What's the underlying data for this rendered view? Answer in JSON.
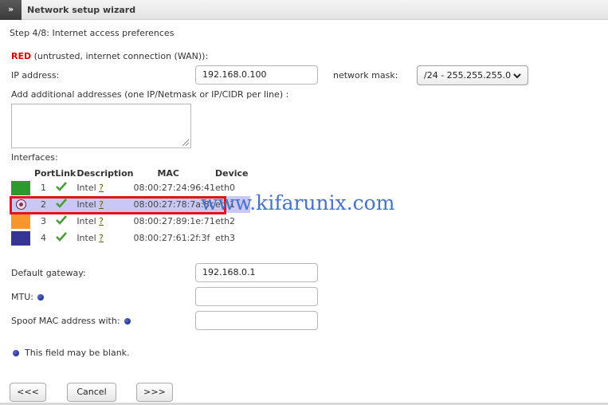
{
  "window": {
    "toggle_glyph": "»",
    "title": "Network setup wizard"
  },
  "step": "Step 4/8: Internet access preferences",
  "red_section": {
    "label": "RED",
    "desc": " (untrusted, internet connection (WAN)):"
  },
  "ip_address": {
    "label": "IP address:",
    "value": "192.168.0.100"
  },
  "network_mask": {
    "label": "network mask:",
    "value": "/24 - 255.255.255.0"
  },
  "additional_addresses": {
    "label": "Add additional addresses (one IP/Netmask or IP/CIDR per line) :",
    "value": ""
  },
  "interfaces": {
    "label": "Interfaces:",
    "columns": {
      "port": "Port",
      "link": "Link",
      "description": "Description",
      "mac": "MAC",
      "device": "Device"
    },
    "rows": [
      {
        "color": "#2d9a2d",
        "port": "1",
        "description": "Intel",
        "help": "?",
        "mac": "08:00:27:24:96:41",
        "device": "eth0",
        "selected": false
      },
      {
        "color": "#c9c8f5",
        "port": "2",
        "description": "Intel",
        "help": "?",
        "mac": "08:00:27:78:7a:8c",
        "device": "eth1",
        "selected": true
      },
      {
        "color": "#f7962c",
        "port": "3",
        "description": "Intel",
        "help": "?",
        "mac": "08:00:27:89:1e:71",
        "device": "eth2",
        "selected": false
      },
      {
        "color": "#363596",
        "port": "4",
        "description": "Intel",
        "help": "?",
        "mac": "08:00:27:61:2f:3f",
        "device": "eth3",
        "selected": false
      }
    ]
  },
  "watermark": "www.kifarunix.com",
  "default_gateway": {
    "label": "Default gateway:",
    "value": "192.168.0.1"
  },
  "mtu": {
    "label": "MTU:",
    "value": ""
  },
  "spoof_mac": {
    "label": "Spoof MAC address with:",
    "value": ""
  },
  "note": "This field may be blank.",
  "buttons": {
    "back": "<<<",
    "cancel": "Cancel",
    "next": ">>>"
  },
  "colors": {
    "accent_red": "#d40000",
    "highlight_box": "#e0141e",
    "selected_row": "#c9c8f5"
  }
}
